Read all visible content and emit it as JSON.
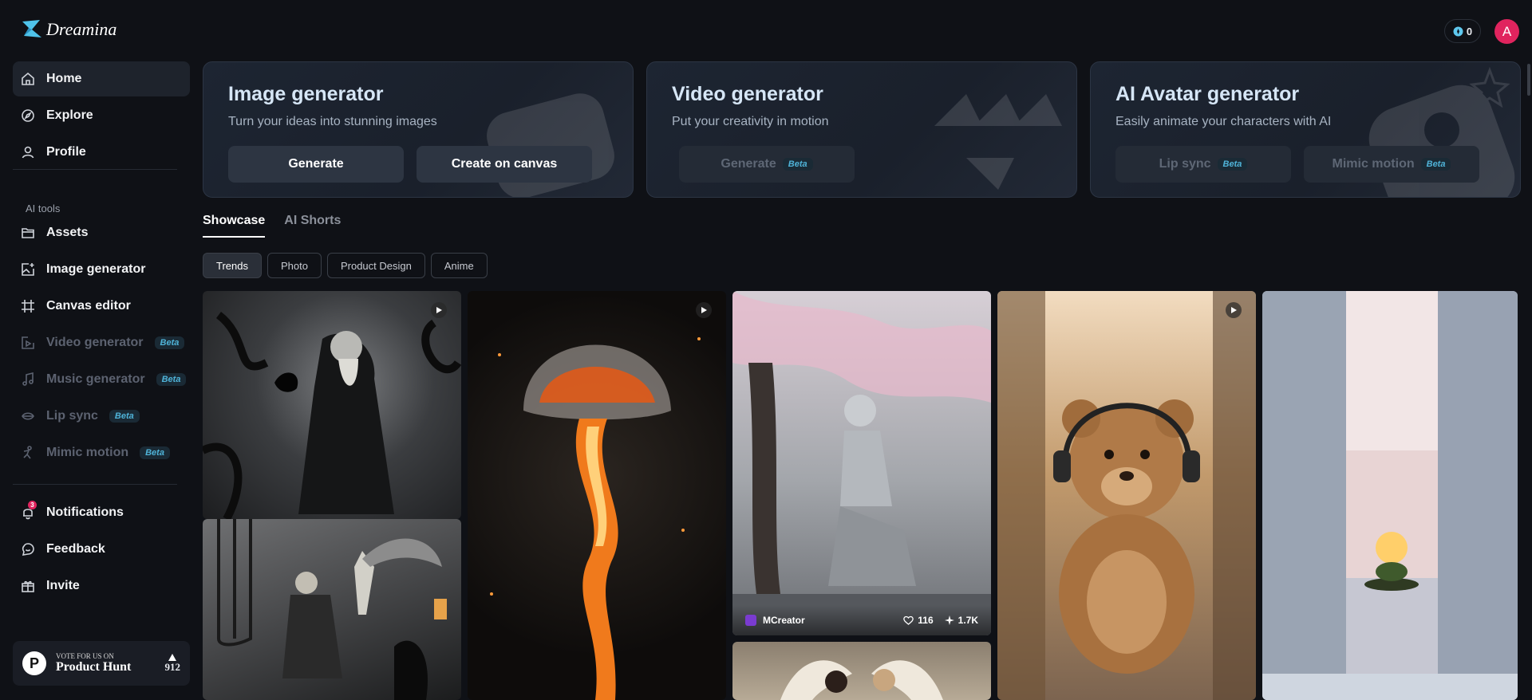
{
  "app": {
    "name": "Dreamina"
  },
  "sidebar": {
    "main_items": [
      {
        "label": "Home",
        "icon": "home-icon",
        "active": true
      },
      {
        "label": "Explore",
        "icon": "compass-icon"
      },
      {
        "label": "Profile",
        "icon": "user-icon"
      }
    ],
    "section_label": "AI tools",
    "tool_items": [
      {
        "label": "Assets",
        "icon": "folder-icon"
      },
      {
        "label": "Image generator",
        "icon": "image-plus-icon"
      },
      {
        "label": "Canvas editor",
        "icon": "canvas-icon"
      },
      {
        "label": "Video generator",
        "icon": "video-icon",
        "badge": "Beta",
        "disabled": true
      },
      {
        "label": "Music generator",
        "icon": "music-icon",
        "badge": "Beta",
        "disabled": true
      },
      {
        "label": "Lip sync",
        "icon": "lips-icon",
        "badge": "Beta",
        "disabled": true
      },
      {
        "label": "Mimic motion",
        "icon": "motion-icon",
        "badge": "Beta",
        "disabled": true
      }
    ],
    "bottom_items": [
      {
        "label": "Notifications",
        "icon": "bell-icon",
        "count": "3"
      },
      {
        "label": "Feedback",
        "icon": "feedback-icon"
      },
      {
        "label": "Invite",
        "icon": "invite-icon"
      }
    ],
    "product_hunt": {
      "small": "VOTE FOR US ON",
      "big": "Product Hunt",
      "count": "912",
      "logo_letter": "P"
    }
  },
  "topbar": {
    "credits": "0",
    "avatar_letter": "A"
  },
  "cards": [
    {
      "title": "Image generator",
      "subtitle": "Turn your ideas into stunning images",
      "buttons": [
        {
          "label": "Generate"
        },
        {
          "label": "Create on canvas"
        }
      ]
    },
    {
      "title": "Video generator",
      "subtitle": "Put your creativity in motion",
      "buttons": [
        {
          "label": "Generate",
          "badge": "Beta",
          "disabled": true
        }
      ]
    },
    {
      "title": "AI Avatar generator",
      "subtitle": "Easily animate your characters with AI",
      "buttons": [
        {
          "label": "Lip sync",
          "badge": "Beta",
          "disabled": true
        },
        {
          "label": "Mimic motion",
          "badge": "Beta",
          "disabled": true
        }
      ]
    }
  ],
  "tabs": [
    {
      "label": "Showcase",
      "active": true
    },
    {
      "label": "AI Shorts"
    }
  ],
  "chips": [
    {
      "label": "Trends",
      "active": true
    },
    {
      "label": "Photo"
    },
    {
      "label": "Product Design"
    },
    {
      "label": "Anime"
    }
  ],
  "showcase": [
    {
      "author": "MCreator",
      "likes": "116",
      "remixes": "1.7K"
    }
  ],
  "colors": {
    "accent": "#e0245e",
    "beta": "#4fb3d8",
    "bg": "#0f1116"
  }
}
